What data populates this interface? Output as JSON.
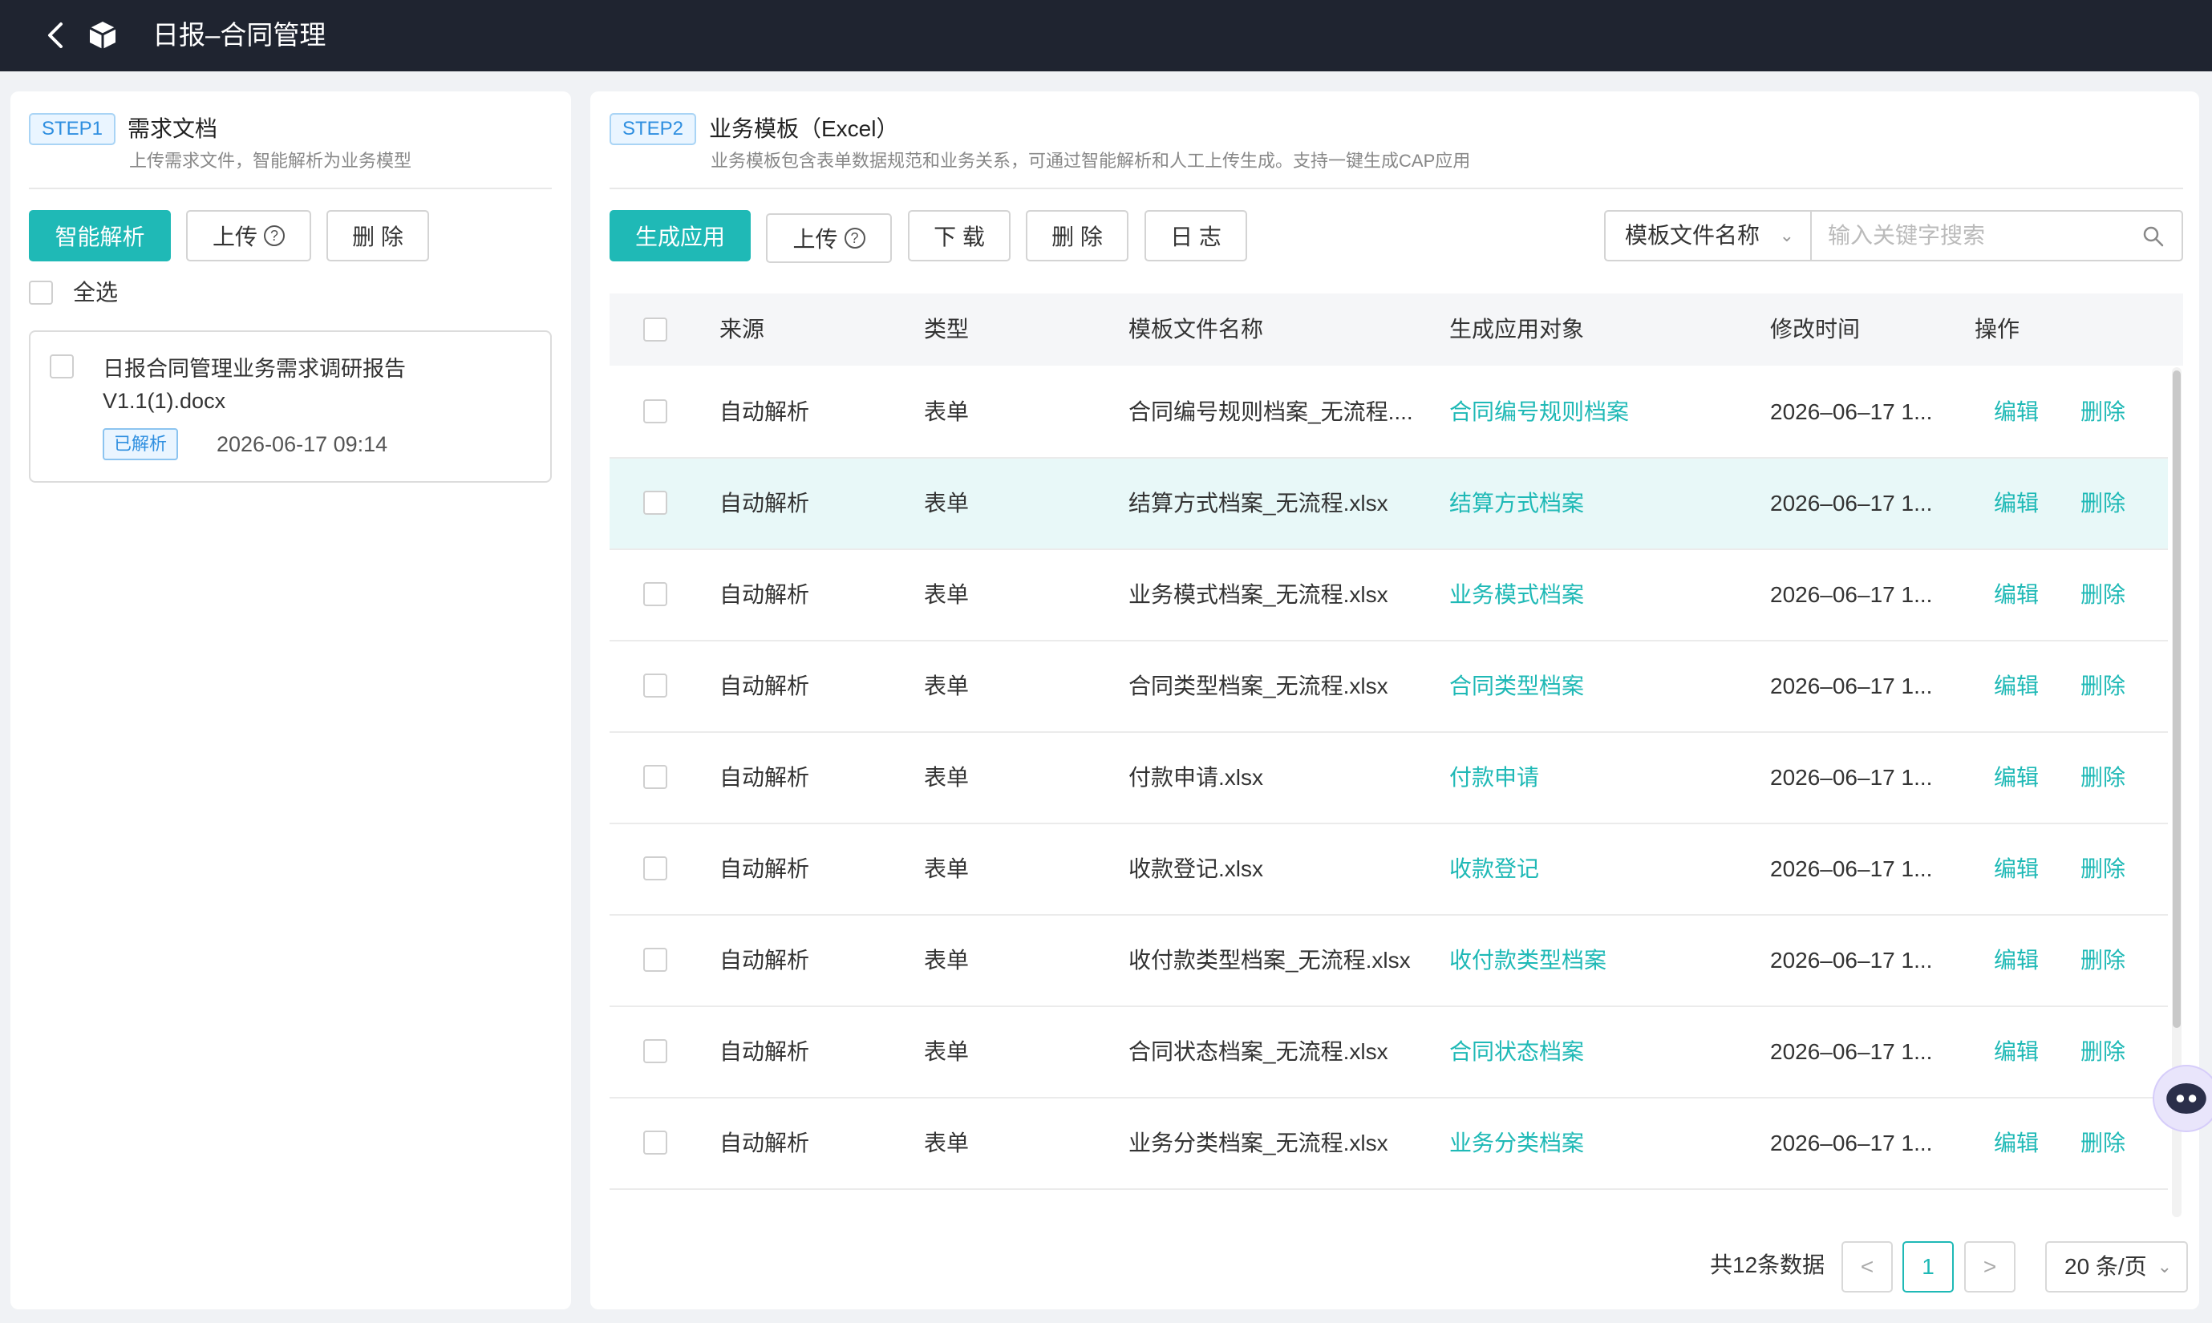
{
  "header": {
    "title": "日报–合同管理",
    "back_icon": "chevron-left-icon",
    "logo_icon": "cube-icon"
  },
  "step1": {
    "tag": "STEP1",
    "title": "需求文档",
    "subtitle": "上传需求文件，智能解析为业务模型",
    "buttons": {
      "parse": "智能解析",
      "upload": "上传",
      "delete": "删 除"
    },
    "select_all": "全选",
    "files": [
      {
        "name": "日报合同管理业务需求调研报告V1.1(1).docx",
        "status": "已解析",
        "time": "2026-06-17 09:14"
      }
    ]
  },
  "step2": {
    "tag": "STEP2",
    "title": "业务模板（Excel）",
    "subtitle": "业务模板包含表单数据规范和业务关系，可通过智能解析和人工上传生成。支持一键生成CAP应用",
    "buttons": {
      "generate": "生成应用",
      "upload": "上传",
      "download": "下 载",
      "delete": "删 除",
      "log": "日 志"
    },
    "search": {
      "field": "模板文件名称",
      "placeholder": "输入关键字搜索"
    },
    "columns": {
      "source": "来源",
      "type": "类型",
      "file": "模板文件名称",
      "target": "生成应用对象",
      "mtime": "修改时间",
      "ops": "操作"
    },
    "actions": {
      "edit": "编辑",
      "delete": "删除"
    },
    "rows": [
      {
        "source": "自动解析",
        "type": "表单",
        "file": "合同编号规则档案_无流程....",
        "target": "合同编号规则档案",
        "mtime": "2026–06–17 1..."
      },
      {
        "source": "自动解析",
        "type": "表单",
        "file": "结算方式档案_无流程.xlsx",
        "target": "结算方式档案",
        "mtime": "2026–06–17 1..."
      },
      {
        "source": "自动解析",
        "type": "表单",
        "file": "业务模式档案_无流程.xlsx",
        "target": "业务模式档案",
        "mtime": "2026–06–17 1..."
      },
      {
        "source": "自动解析",
        "type": "表单",
        "file": "合同类型档案_无流程.xlsx",
        "target": "合同类型档案",
        "mtime": "2026–06–17 1..."
      },
      {
        "source": "自动解析",
        "type": "表单",
        "file": "付款申请.xlsx",
        "target": "付款申请",
        "mtime": "2026–06–17 1..."
      },
      {
        "source": "自动解析",
        "type": "表单",
        "file": "收款登记.xlsx",
        "target": "收款登记",
        "mtime": "2026–06–17 1..."
      },
      {
        "source": "自动解析",
        "type": "表单",
        "file": "收付款类型档案_无流程.xlsx",
        "target": "收付款类型档案",
        "mtime": "2026–06–17 1..."
      },
      {
        "source": "自动解析",
        "type": "表单",
        "file": "合同状态档案_无流程.xlsx",
        "target": "合同状态档案",
        "mtime": "2026–06–17 1..."
      },
      {
        "source": "自动解析",
        "type": "表单",
        "file": "业务分类档案_无流程.xlsx",
        "target": "业务分类档案",
        "mtime": "2026–06–17 1..."
      }
    ],
    "pagination": {
      "total": "共12条数据",
      "prev": "<",
      "current": "1",
      "next": ">",
      "page_size": "20 条/页"
    }
  },
  "colors": {
    "accent": "#1fb9b6",
    "header_bg": "#1f2430",
    "tag_blue": "#2f8fe0",
    "row_highlight": "#e8f8f8"
  }
}
